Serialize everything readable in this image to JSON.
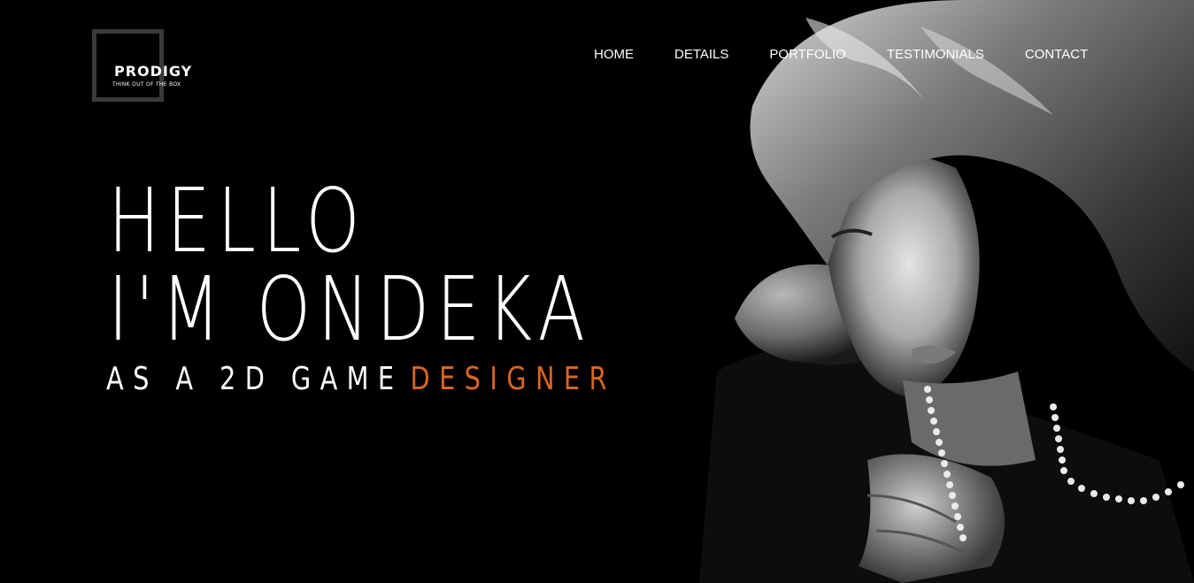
{
  "logo": {
    "title": "PRODIGY",
    "tagline": "THINK OUT OF THE BOX"
  },
  "nav": {
    "items": [
      {
        "label": "HOME"
      },
      {
        "label": "DETAILS"
      },
      {
        "label": "PORTFOLIO"
      },
      {
        "label": "TESTIMONIALS"
      },
      {
        "label": "CONTACT"
      }
    ]
  },
  "hero": {
    "line1": "HELLO",
    "line2": "I'M ONDEKA",
    "subtitle_prefix": "AS A 2D GAME",
    "subtitle_accent": "DESIGNER"
  },
  "colors": {
    "background": "#000000",
    "text": "#ffffff",
    "accent": "#d9661f",
    "logo_box": "#3a3a3a"
  },
  "icons": {
    "portrait": "woman-portrait-photo"
  }
}
